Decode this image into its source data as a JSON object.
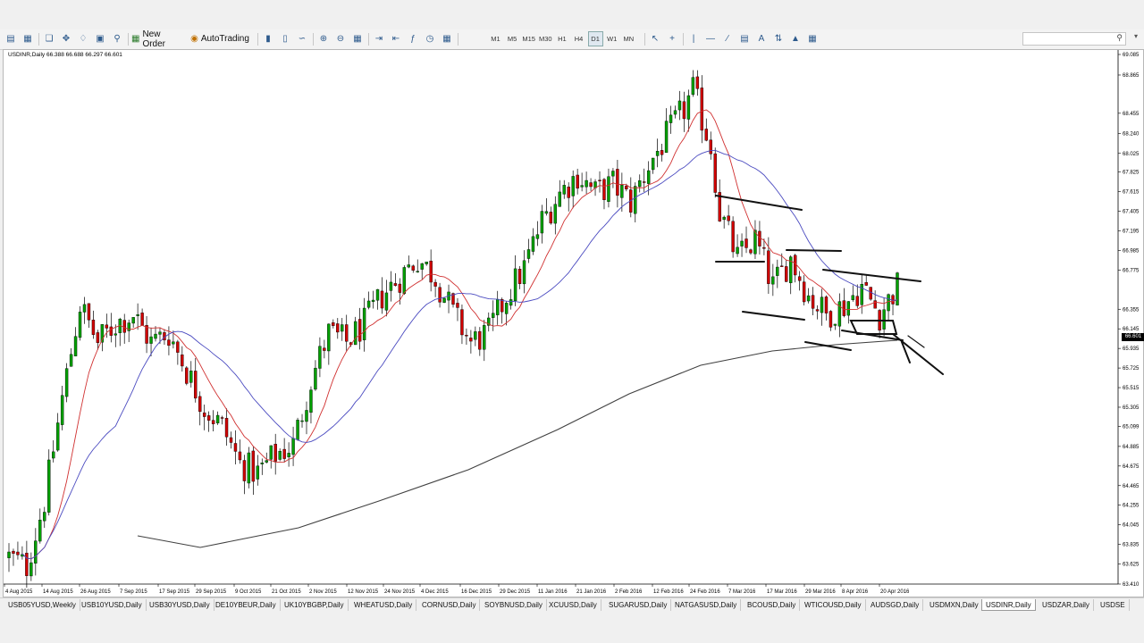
{
  "toolbar": {
    "new_order_label": "New Order",
    "autotrading_label": "AutoTrading",
    "timeframes": [
      "M1",
      "M5",
      "M15",
      "M30",
      "H1",
      "H4",
      "D1",
      "W1",
      "MN"
    ],
    "active_timeframe": "D1",
    "icons": [
      "new-chart-icon",
      "profiles-icon",
      "market-watch-icon",
      "navigator-icon",
      "data-window-icon",
      "terminal-icon",
      "strategy-tester-icon",
      "bar-chart-icon",
      "candles-icon",
      "line-chart-icon",
      "zoom-in-icon",
      "zoom-out-icon",
      "tile-windows-icon",
      "autoscroll-icon",
      "chart-shift-icon",
      "indicators-icon",
      "periods-icon",
      "templates-icon",
      "cursor-icon",
      "crosshair-icon",
      "vertical-line-icon",
      "horizontal-line-icon",
      "trendline-icon",
      "channel-icon",
      "text-icon",
      "arrows-icon",
      "triangle-icon",
      "fibonacci-icon"
    ]
  },
  "search": {
    "placeholder": ""
  },
  "chart": {
    "header": "USDINR,Daily  66.388 66.688 66.297 66.601",
    "symbol": "USDINR",
    "timeframe": "Daily",
    "open": 66.388,
    "high": 66.688,
    "low": 66.297,
    "close": 66.601,
    "current_price_label": "66.601",
    "colors": {
      "bull": "#00a000",
      "bear": "#d00000",
      "ma_fast": "#d03030",
      "ma_mid": "#4a4ac0",
      "ma_slow": "#404040"
    }
  },
  "chart_data": {
    "type": "candlestick",
    "symbol": "USDINR",
    "timeframe": "Daily",
    "y_ticks": [
      "69.085",
      "68.865",
      "68.455",
      "68.240",
      "68.025",
      "67.825",
      "67.615",
      "67.405",
      "67.195",
      "66.985",
      "66.775",
      "66.601",
      "66.355",
      "66.145",
      "65.935",
      "65.725",
      "65.515",
      "65.305",
      "65.099",
      "64.885",
      "64.675",
      "64.465",
      "64.255",
      "64.045",
      "63.835",
      "63.625",
      "63.410"
    ],
    "ylim": [
      63.41,
      69.085
    ],
    "x_ticks": [
      "4 Aug 2015",
      "14 Aug 2015",
      "26 Aug 2015",
      "7 Sep 2015",
      "17 Sep 2015",
      "29 Sep 2015",
      "9 Oct 2015",
      "21 Oct 2015",
      "2 Nov 2015",
      "12 Nov 2015",
      "24 Nov 2015",
      "4 Dec 2015",
      "16 Dec 2015",
      "29 Dec 2015",
      "11 Jan 2016",
      "21 Jan 2016",
      "2 Feb 2016",
      "12 Feb 2016",
      "24 Feb 2016",
      "7 Mar 2016",
      "17 Mar 2016",
      "29 Mar 2016",
      "8 Apr 2016",
      "20 Apr 2016"
    ],
    "close_path": [
      [
        0,
        63.7
      ],
      [
        4,
        63.6
      ],
      [
        8,
        64.3
      ],
      [
        12,
        65.4
      ],
      [
        16,
        66.4
      ],
      [
        20,
        66.0
      ],
      [
        24,
        66.2
      ],
      [
        28,
        66.3
      ],
      [
        32,
        66.0
      ],
      [
        36,
        66.1
      ],
      [
        40,
        65.7
      ],
      [
        44,
        65.3
      ],
      [
        48,
        65.1
      ],
      [
        52,
        64.7
      ],
      [
        56,
        64.6
      ],
      [
        60,
        64.8
      ],
      [
        64,
        64.9
      ],
      [
        68,
        65.6
      ],
      [
        72,
        66.1
      ],
      [
        76,
        66.0
      ],
      [
        80,
        66.2
      ],
      [
        84,
        66.5
      ],
      [
        88,
        66.7
      ],
      [
        92,
        66.9
      ],
      [
        96,
        66.7
      ],
      [
        100,
        66.3
      ],
      [
        104,
        66.0
      ],
      [
        108,
        66.1
      ],
      [
        112,
        66.5
      ],
      [
        116,
        66.8
      ],
      [
        120,
        67.3
      ],
      [
        124,
        67.6
      ],
      [
        128,
        67.8
      ],
      [
        132,
        67.6
      ],
      [
        136,
        67.7
      ],
      [
        140,
        67.5
      ],
      [
        144,
        67.9
      ],
      [
        148,
        68.2
      ],
      [
        152,
        68.5
      ],
      [
        154,
        68.7
      ],
      [
        158,
        68.1
      ],
      [
        160,
        67.4
      ],
      [
        164,
        66.9
      ],
      [
        168,
        67.1
      ],
      [
        172,
        66.6
      ],
      [
        176,
        66.9
      ],
      [
        180,
        66.5
      ],
      [
        184,
        66.3
      ],
      [
        188,
        66.4
      ],
      [
        192,
        66.6
      ],
      [
        196,
        66.3
      ],
      [
        200,
        66.6
      ]
    ],
    "moving_averages": [
      {
        "name": "MA fast",
        "color": "#d03030"
      },
      {
        "name": "MA mid",
        "color": "#4a4ac0"
      },
      {
        "name": "MA slow",
        "color": "#404040"
      }
    ],
    "drawings": "hand-drawn channel lines and arrow"
  },
  "tabs": [
    "USB05YUSD,Weekly",
    "USB10YUSD,Daily",
    "USB30YUSD,Daily",
    "DE10YBEUR,Daily",
    "UK10YBGBP,Daily",
    "WHEATUSD,Daily",
    "CORNUSD,Daily",
    "SOYBNUSD,Daily",
    "XCUUSD,Daily",
    "SUGARUSD,Daily",
    "NATGASUSD,Daily",
    "BCOUSD,Daily",
    "WTICOUSD,Daily",
    "AUDSGD,Daily",
    "USDMXN,Daily",
    "USDINR,Daily",
    "USDZAR,Daily",
    "USDSE"
  ],
  "active_tab": "USDINR,Daily"
}
